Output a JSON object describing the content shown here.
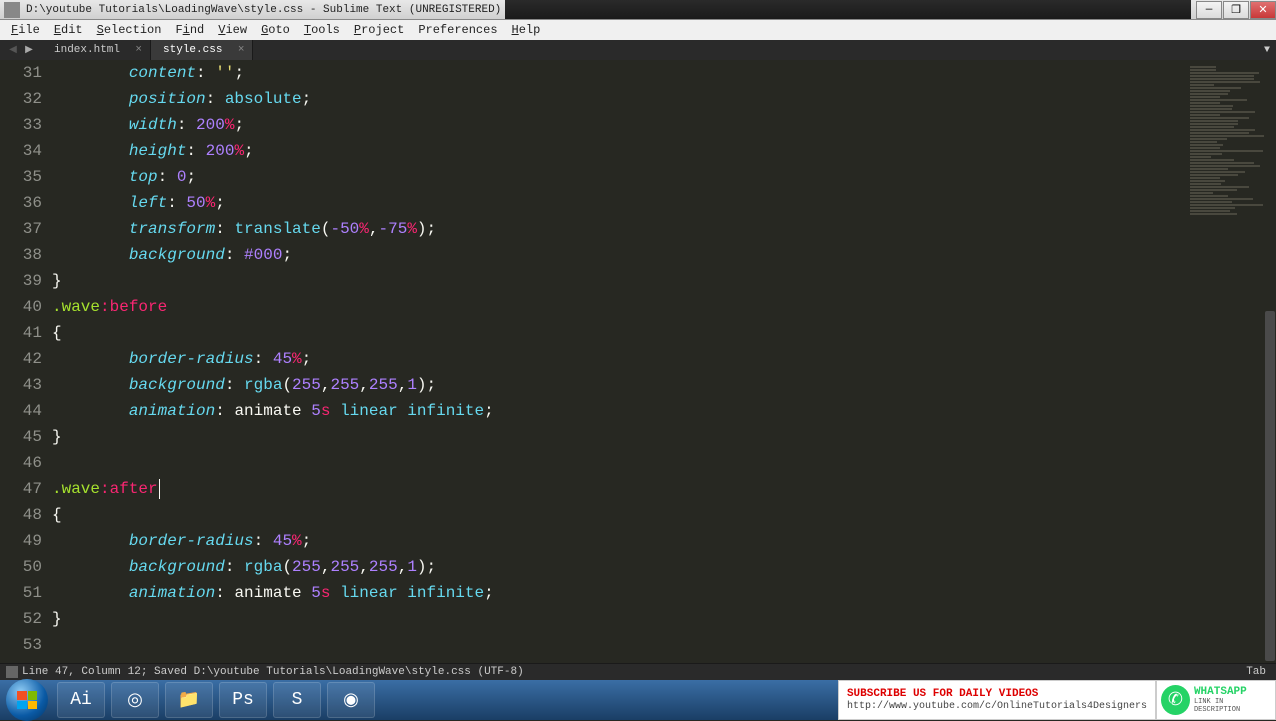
{
  "window": {
    "title": "D:\\youtube Tutorials\\LoadingWave\\style.css - Sublime Text (UNREGISTERED)"
  },
  "menu": {
    "file": "File",
    "edit": "Edit",
    "selection": "Selection",
    "find": "Find",
    "view": "View",
    "goto": "Goto",
    "tools": "Tools",
    "project": "Project",
    "preferences": "Preferences",
    "help": "Help"
  },
  "tabs": {
    "t0": "index.html",
    "t1": "style.css"
  },
  "gutter": {
    "start": 31,
    "end": 53
  },
  "code": {
    "lines": [
      {
        "indent": 2,
        "tokens": [
          [
            "prop",
            "content"
          ],
          [
            "punc",
            ": "
          ],
          [
            "str",
            "''"
          ],
          [
            "punc",
            ";"
          ]
        ]
      },
      {
        "indent": 2,
        "tokens": [
          [
            "prop",
            "position"
          ],
          [
            "punc",
            ": "
          ],
          [
            "val",
            "absolute"
          ],
          [
            "punc",
            ";"
          ]
        ]
      },
      {
        "indent": 2,
        "tokens": [
          [
            "prop",
            "width"
          ],
          [
            "punc",
            ": "
          ],
          [
            "num",
            "200"
          ],
          [
            "unit",
            "%"
          ],
          [
            "punc",
            ";"
          ]
        ]
      },
      {
        "indent": 2,
        "tokens": [
          [
            "prop",
            "height"
          ],
          [
            "punc",
            ": "
          ],
          [
            "num",
            "200"
          ],
          [
            "unit",
            "%"
          ],
          [
            "punc",
            ";"
          ]
        ]
      },
      {
        "indent": 2,
        "tokens": [
          [
            "prop",
            "top"
          ],
          [
            "punc",
            ": "
          ],
          [
            "num",
            "0"
          ],
          [
            "punc",
            ";"
          ]
        ]
      },
      {
        "indent": 2,
        "tokens": [
          [
            "prop",
            "left"
          ],
          [
            "punc",
            ": "
          ],
          [
            "num",
            "50"
          ],
          [
            "unit",
            "%"
          ],
          [
            "punc",
            ";"
          ]
        ]
      },
      {
        "indent": 2,
        "tokens": [
          [
            "prop",
            "transform"
          ],
          [
            "punc",
            ": "
          ],
          [
            "func",
            "translate"
          ],
          [
            "punc",
            "("
          ],
          [
            "num",
            "-50"
          ],
          [
            "unit",
            "%"
          ],
          [
            "punc",
            ","
          ],
          [
            "num",
            "-75"
          ],
          [
            "unit",
            "%"
          ],
          [
            "punc",
            ");"
          ]
        ]
      },
      {
        "indent": 2,
        "tokens": [
          [
            "prop",
            "background"
          ],
          [
            "punc",
            ": "
          ],
          [
            "num",
            "#000"
          ],
          [
            "punc",
            ";"
          ]
        ]
      },
      {
        "indent": 0,
        "tokens": [
          [
            "punc",
            "}"
          ]
        ]
      },
      {
        "indent": 0,
        "tokens": [
          [
            "sel",
            ".wave"
          ],
          [
            "kw",
            ":before"
          ]
        ]
      },
      {
        "indent": 0,
        "tokens": [
          [
            "punc",
            "{"
          ]
        ]
      },
      {
        "indent": 2,
        "tokens": [
          [
            "prop",
            "border-radius"
          ],
          [
            "punc",
            ": "
          ],
          [
            "num",
            "45"
          ],
          [
            "unit",
            "%"
          ],
          [
            "punc",
            ";"
          ]
        ]
      },
      {
        "indent": 2,
        "tokens": [
          [
            "prop",
            "background"
          ],
          [
            "punc",
            ": "
          ],
          [
            "func",
            "rgba"
          ],
          [
            "punc",
            "("
          ],
          [
            "num",
            "255"
          ],
          [
            "punc",
            ","
          ],
          [
            "num",
            "255"
          ],
          [
            "punc",
            ","
          ],
          [
            "num",
            "255"
          ],
          [
            "punc",
            ","
          ],
          [
            "num",
            "1"
          ],
          [
            "punc",
            ");"
          ]
        ]
      },
      {
        "indent": 2,
        "tokens": [
          [
            "prop",
            "animation"
          ],
          [
            "punc",
            ": "
          ],
          [
            "punc",
            "animate "
          ],
          [
            "num",
            "5"
          ],
          [
            "unit",
            "s"
          ],
          [
            "punc",
            " "
          ],
          [
            "val",
            "linear"
          ],
          [
            "punc",
            " "
          ],
          [
            "val",
            "infinite"
          ],
          [
            "punc",
            ";"
          ]
        ]
      },
      {
        "indent": 0,
        "tokens": [
          [
            "punc",
            "}"
          ]
        ]
      },
      {
        "indent": 0,
        "tokens": []
      },
      {
        "indent": 0,
        "caret": true,
        "tokens": [
          [
            "sel",
            ".wave"
          ],
          [
            "kw",
            ":after"
          ]
        ]
      },
      {
        "indent": 0,
        "tokens": [
          [
            "punc",
            "{"
          ]
        ]
      },
      {
        "indent": 2,
        "tokens": [
          [
            "prop",
            "border-radius"
          ],
          [
            "punc",
            ": "
          ],
          [
            "num",
            "45"
          ],
          [
            "unit",
            "%"
          ],
          [
            "punc",
            ";"
          ]
        ]
      },
      {
        "indent": 2,
        "tokens": [
          [
            "prop",
            "background"
          ],
          [
            "punc",
            ": "
          ],
          [
            "func",
            "rgba"
          ],
          [
            "punc",
            "("
          ],
          [
            "num",
            "255"
          ],
          [
            "punc",
            ","
          ],
          [
            "num",
            "255"
          ],
          [
            "punc",
            ","
          ],
          [
            "num",
            "255"
          ],
          [
            "punc",
            ","
          ],
          [
            "num",
            "1"
          ],
          [
            "punc",
            ");"
          ]
        ]
      },
      {
        "indent": 2,
        "tokens": [
          [
            "prop",
            "animation"
          ],
          [
            "punc",
            ": "
          ],
          [
            "punc",
            "animate "
          ],
          [
            "num",
            "5"
          ],
          [
            "unit",
            "s"
          ],
          [
            "punc",
            " "
          ],
          [
            "val",
            "linear"
          ],
          [
            "punc",
            " "
          ],
          [
            "val",
            "infinite"
          ],
          [
            "punc",
            ";"
          ]
        ]
      },
      {
        "indent": 0,
        "tokens": [
          [
            "punc",
            "}"
          ]
        ]
      },
      {
        "indent": 0,
        "tokens": []
      }
    ]
  },
  "statusbar": {
    "left": "Line 47, Column 12; Saved D:\\youtube Tutorials\\LoadingWave\\style.css (UTF-8)",
    "right": "Tab"
  },
  "overlay": {
    "subscribe_line1": "SUBSCRIBE US FOR DAILY VIDEOS",
    "subscribe_line2": "http://www.youtube.com/c/OnlineTutorials4Designers",
    "whatsapp_title": "WHATSAPP",
    "whatsapp_sub": "LINK IN DESCRIPTION"
  }
}
